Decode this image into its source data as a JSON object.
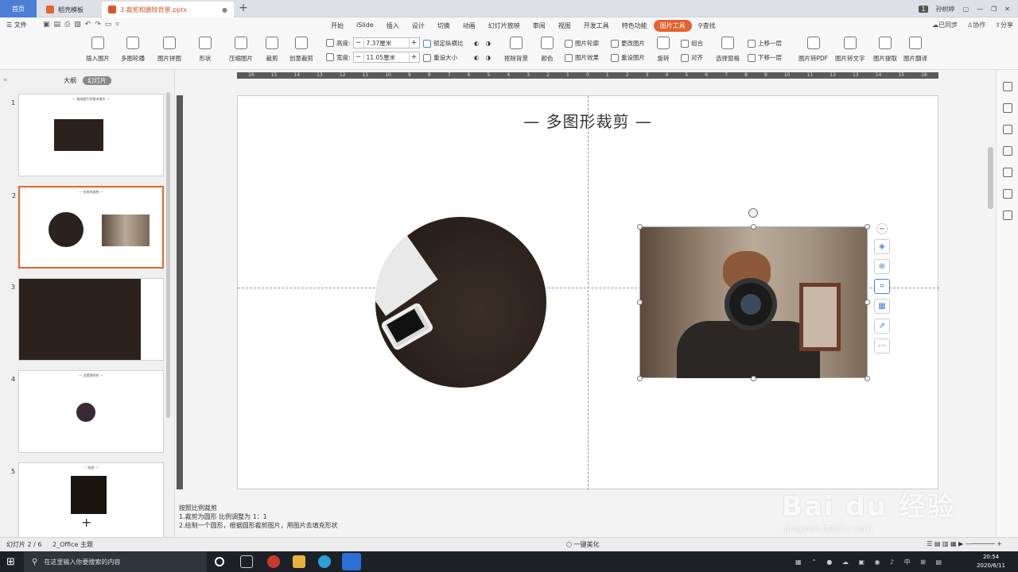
{
  "titlebar": {
    "tabs": [
      {
        "label": "首页"
      },
      {
        "label": "稻壳模板"
      },
      {
        "label": "3.裁剪和删除背景.pptx"
      }
    ],
    "badge": "1",
    "user": "孙树婷"
  },
  "menubar": {
    "file_label": "文件",
    "items": [
      "开始",
      "iSlide",
      "插入",
      "设计",
      "切换",
      "动画",
      "幻灯片放映",
      "审阅",
      "视图",
      "开发工具",
      "特色功能",
      "图片工具",
      "查找"
    ],
    "active_item": "图片工具",
    "right": [
      "已同步",
      "协作",
      "分享"
    ]
  },
  "ribbon": {
    "buttons": [
      "插入图片",
      "多图轮播",
      "图片拼图",
      "形状",
      "压缩图片",
      "裁剪",
      "创意裁剪",
      "抠除背景",
      "颜色",
      "旋转",
      "对齐",
      "选择窗格",
      "图片转PDF",
      "图片转文字",
      "图片提取",
      "图片翻译"
    ],
    "height_label": "高度:",
    "height_value": "7.37厘米",
    "width_label": "宽度:",
    "width_value": "11.05厘米",
    "lock_ratio": "锁定纵横比",
    "reset_size": "重设大小",
    "picture_border": "图片轮廓",
    "picture_effect": "图片效果",
    "change_picture": "更改图片",
    "reset_picture": "重设图片",
    "group": "组合",
    "bring_forward": "上移一层",
    "send_backward": "下移一层"
  },
  "left_panel": {
    "tabs": [
      "大纲",
      "幻灯片"
    ],
    "active_tab": "幻灯片",
    "slides": [
      {
        "num": "1",
        "title": "— 截成图片的基本操作 —"
      },
      {
        "num": "2",
        "title": "— 多图形裁剪 —"
      },
      {
        "num": "3",
        "title": ""
      },
      {
        "num": "4",
        "title": "— 设置透明色 —"
      },
      {
        "num": "5",
        "title": "— 抠图 —"
      }
    ]
  },
  "ruler_labels": [
    "16",
    "15",
    "14",
    "13",
    "12",
    "11",
    "10",
    "9",
    "8",
    "7",
    "6",
    "5",
    "4",
    "3",
    "2",
    "1",
    "0",
    "1",
    "2",
    "3",
    "4",
    "5",
    "6",
    "7",
    "8",
    "9",
    "10",
    "11",
    "12",
    "13",
    "14",
    "15",
    "16"
  ],
  "slide": {
    "title": "— 多图形裁剪 —"
  },
  "notes": {
    "line1": "按照比例裁剪",
    "line2": "1.裁剪为圆形 比例调整为 1：1",
    "line3": "2.绘制一个圆形，根据圆形裁剪图片，用图片去填充形状"
  },
  "statusbar": {
    "slide_info": "幻灯片 2 / 6",
    "theme": "2_Office 主题",
    "beautify": "一键美化"
  },
  "taskbar": {
    "search_placeholder": "在这里输入你要搜索的内容",
    "time": "20:54",
    "date": "2020/6/11"
  },
  "watermark": {
    "text": "Bai du 经验",
    "url": "jingyan.baidu.com"
  },
  "colors": {
    "accent": "#e4632e",
    "home_tab": "#4b7fd6"
  }
}
